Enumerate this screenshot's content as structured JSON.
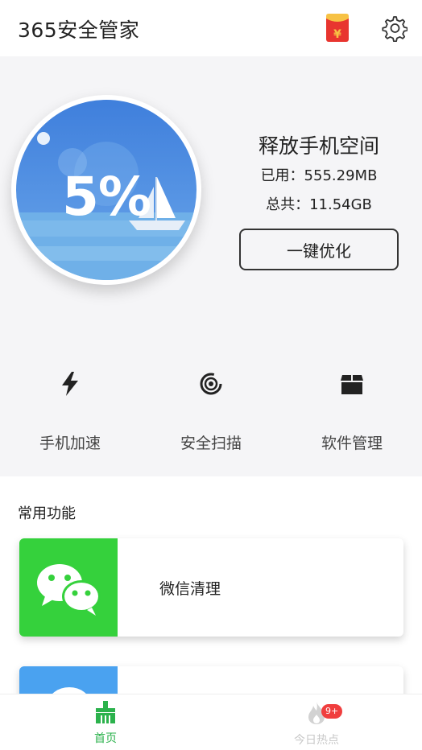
{
  "header": {
    "title": "365安全管家",
    "redpacket_icon": "red-packet-icon",
    "redpacket_glyph": "¥",
    "settings_icon": "gear-icon"
  },
  "hero": {
    "usage_percent": "5%",
    "usage_fraction": 0.05,
    "title": "释放手机空间",
    "used_text": "已用：555.29MB",
    "total_text": "总共：11.54GB",
    "optimize_label": "一键优化"
  },
  "tools": [
    {
      "label": "手机加速",
      "icon": "lightning-icon"
    },
    {
      "label": "安全扫描",
      "icon": "scan-icon"
    },
    {
      "label": "软件管理",
      "icon": "box-icon"
    }
  ],
  "common": {
    "title": "常用功能",
    "cards": [
      {
        "label": "微信清理",
        "icon": "wechat-icon",
        "color": "#35d13c"
      },
      {
        "label": "",
        "icon": "chat-icon",
        "color": "#4aa2f0"
      }
    ]
  },
  "bottom_nav": {
    "items": [
      {
        "label": "首页",
        "icon": "broom-icon",
        "active": true
      },
      {
        "label": "今日热点",
        "icon": "flame-icon",
        "badge": "9+"
      }
    ]
  },
  "colors": {
    "accent_green": "#2bb24c",
    "gauge_blue": "#4a8fe0",
    "badge_red": "#f03e3e"
  }
}
